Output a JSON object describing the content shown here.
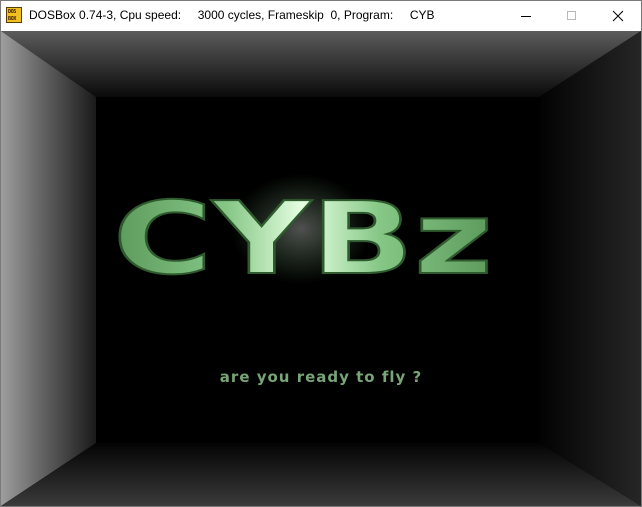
{
  "window": {
    "title": "DOSBox 0.74-3, Cpu speed:     3000 cycles, Frameskip  0, Program:     CYB",
    "icon_line1": "DOS",
    "icon_line2": "BOX",
    "icon": "dosbox-icon",
    "controls": [
      "minimize-icon",
      "maximize-icon",
      "close-icon"
    ]
  },
  "game": {
    "logo_text": "CYBz",
    "tagline": "are you ready to fly ?",
    "colors": {
      "logo_green": "#69c26a",
      "logo_glow": "#e8ffe6",
      "tagline_green": "#78a478",
      "corridor_light": "#a0a0a0",
      "corridor_dark": "#000000"
    }
  }
}
